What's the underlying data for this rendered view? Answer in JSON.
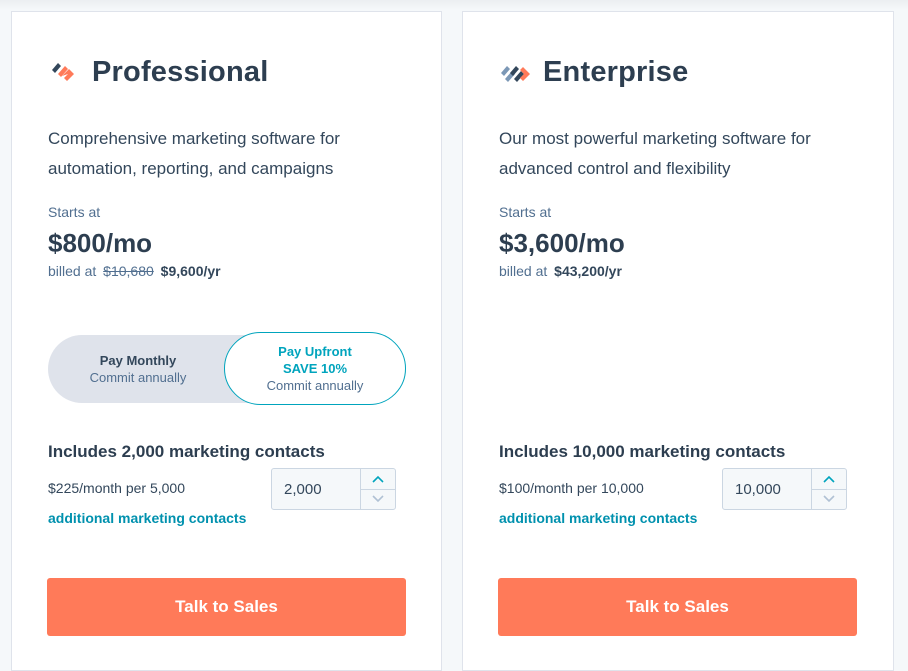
{
  "plans": [
    {
      "name": "Professional",
      "icon": "professional-plan-icon",
      "description": "Comprehensive marketing software for automation, reporting, and campaigns",
      "starts_at_label": "Starts at",
      "price": "$800/mo",
      "billed_prefix": "billed at",
      "billed_original": "$10,680",
      "billed_annual": "$9,600/yr",
      "toggle": {
        "monthly_label": "Pay Monthly",
        "monthly_sub": "Commit annually",
        "upfront_label": "Pay Upfront",
        "upfront_save": "SAVE 10%",
        "upfront_sub": "Commit annually"
      },
      "includes": "Includes 2,000 marketing contacts",
      "addon_price": "$225/month per 5,000",
      "addon_link": "additional marketing contacts",
      "contacts_value": "2,000",
      "cta": "Talk to Sales"
    },
    {
      "name": "Enterprise",
      "icon": "enterprise-plan-icon",
      "description": "Our most powerful marketing software for advanced control and flexibility",
      "starts_at_label": "Starts at",
      "price": "$3,600/mo",
      "billed_prefix": "billed at",
      "billed_annual": "$43,200/yr",
      "includes": "Includes 10,000 marketing contacts",
      "addon_price": "$100/month per 10,000",
      "addon_link": "additional marketing contacts",
      "contacts_value": "10,000",
      "cta": "Talk to Sales"
    }
  ],
  "colors": {
    "accent_teal": "#00a4bd",
    "cta_orange": "#ff7a59",
    "heading": "#2d3e50",
    "link": "#0091ae"
  }
}
